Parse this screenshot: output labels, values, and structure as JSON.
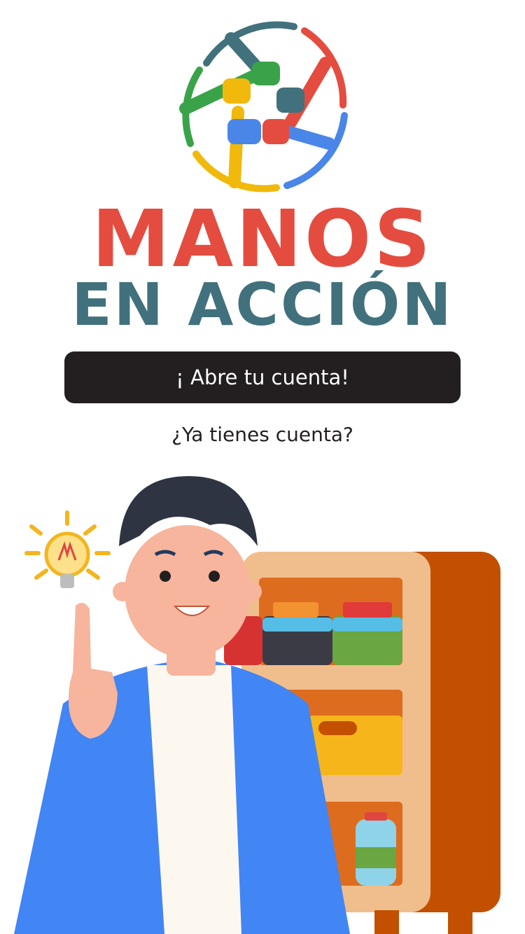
{
  "brand": {
    "line1": "MANOS",
    "line2": "EN ACCIÓN",
    "colors": {
      "red": "#e44c3f",
      "teal": "#41717c",
      "green": "#3aa34a",
      "yellow": "#f0b90b",
      "blue": "#4a86e8"
    }
  },
  "cta": {
    "label": "¡ Abre tu cuenta!"
  },
  "login": {
    "label": "¿Ya tienes cuenta?"
  },
  "illustration": {
    "icon": "person-with-idea-illustration"
  }
}
